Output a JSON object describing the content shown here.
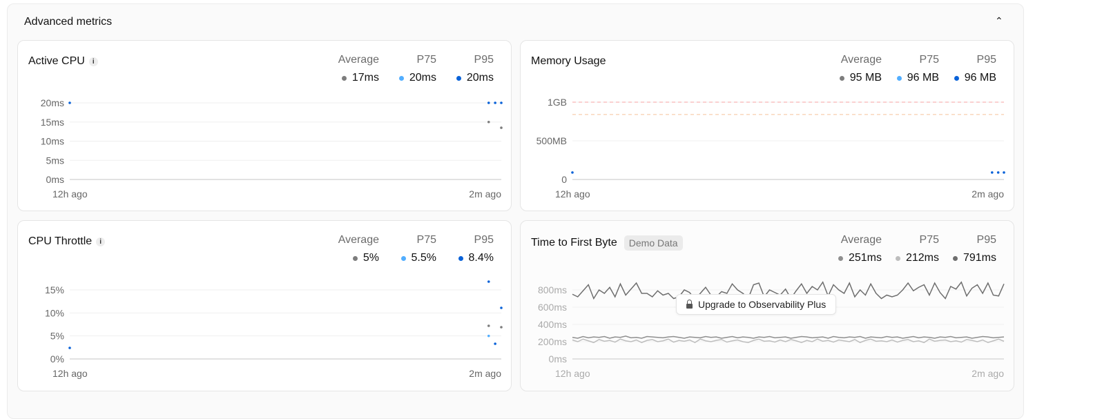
{
  "panel": {
    "title": "Advanced metrics",
    "collapse_icon": "chevron-up-icon",
    "collapse_glyph": "⌃"
  },
  "upgrade_label": "Upgrade to Observability Plus",
  "colors": {
    "avg": "#7d7d7d",
    "p75": "#52aeff",
    "p95": "#0a62d8",
    "demo_avg": "#8f8f8f",
    "demo_p75": "#bdbdbd",
    "demo_p95": "#6e6e6e",
    "limit": "#f7a0a0",
    "warn": "#f5c49a"
  },
  "cards": [
    {
      "id": "active-cpu",
      "title": "Active CPU",
      "info": true,
      "stats": [
        {
          "label": "Average",
          "value": "17ms",
          "color": "avg"
        },
        {
          "label": "P75",
          "value": "20ms",
          "color": "p75"
        },
        {
          "label": "P95",
          "value": "20ms",
          "color": "p95"
        }
      ],
      "chart_data": {
        "type": "scatter",
        "ylim": [
          0,
          20
        ],
        "yticks": [
          "0ms",
          "5ms",
          "10ms",
          "15ms",
          "20ms"
        ],
        "ytick_values": [
          0,
          5,
          10,
          15,
          20
        ],
        "x_labels": [
          "12h ago",
          "2m ago"
        ],
        "xlim_hours_ago": [
          12,
          0
        ],
        "series": [
          {
            "name": "P95",
            "color": "p95",
            "points": [
              [
                12,
                20
              ],
              [
                0.35,
                20
              ],
              [
                0.17,
                20
              ],
              [
                0,
                20
              ]
            ]
          },
          {
            "name": "Average",
            "color": "avg",
            "points": [
              [
                0.35,
                15
              ],
              [
                0,
                13.5
              ]
            ]
          }
        ]
      }
    },
    {
      "id": "memory-usage",
      "title": "Memory Usage",
      "info": false,
      "stats": [
        {
          "label": "Average",
          "value": "95 MB",
          "color": "avg"
        },
        {
          "label": "P75",
          "value": "96 MB",
          "color": "p75"
        },
        {
          "label": "P95",
          "value": "96 MB",
          "color": "p95"
        }
      ],
      "chart_data": {
        "type": "scatter",
        "ylim": [
          0,
          1000
        ],
        "yticks": [
          "0",
          "500MB",
          "1GB"
        ],
        "ytick_values": [
          0,
          500,
          1000
        ],
        "x_labels": [
          "12h ago",
          "2m ago"
        ],
        "xlim_hours_ago": [
          12,
          0
        ],
        "reference_lines": [
          {
            "value": 1000,
            "color": "limit"
          },
          {
            "value": 840,
            "color": "warn"
          }
        ],
        "series": [
          {
            "name": "P95",
            "color": "p95",
            "points": [
              [
                12,
                90
              ],
              [
                0.33,
                90
              ],
              [
                0.16,
                90
              ],
              [
                0,
                90
              ]
            ]
          }
        ]
      }
    },
    {
      "id": "cpu-throttle",
      "title": "CPU Throttle",
      "info": true,
      "stats": [
        {
          "label": "Average",
          "value": "5%",
          "color": "avg"
        },
        {
          "label": "P75",
          "value": "5.5%",
          "color": "p75"
        },
        {
          "label": "P95",
          "value": "8.4%",
          "color": "p95"
        }
      ],
      "chart_data": {
        "type": "scatter",
        "ylim": [
          0,
          15
        ],
        "yticks": [
          "0%",
          "5%",
          "10%",
          "15%"
        ],
        "ytick_values": [
          0,
          5,
          10,
          15
        ],
        "x_labels": [
          "12h ago",
          "2m ago"
        ],
        "xlim_hours_ago": [
          12,
          0
        ],
        "series": [
          {
            "name": "P95",
            "color": "p95",
            "points": [
              [
                12,
                2.4
              ],
              [
                0.35,
                16.8
              ],
              [
                0.17,
                3.3
              ],
              [
                0,
                11.1
              ]
            ]
          },
          {
            "name": "P75",
            "color": "p75",
            "points": [
              [
                0.35,
                5
              ]
            ]
          },
          {
            "name": "Average",
            "color": "avg",
            "points": [
              [
                0.35,
                7.2
              ],
              [
                0,
                6.9
              ]
            ]
          }
        ]
      }
    },
    {
      "id": "ttfb",
      "title": "Time to First Byte",
      "badge": "Demo Data",
      "info": false,
      "demo": true,
      "stats": [
        {
          "label": "Average",
          "value": "251ms",
          "color": "demo_avg"
        },
        {
          "label": "P75",
          "value": "212ms",
          "color": "demo_p75"
        },
        {
          "label": "P95",
          "value": "791ms",
          "color": "demo_p95"
        }
      ],
      "chart_data": {
        "type": "line",
        "ylim": [
          0,
          900
        ],
        "yticks": [
          "0ms",
          "200ms",
          "400ms",
          "600ms",
          "800ms"
        ],
        "ytick_values": [
          0,
          200,
          400,
          600,
          800
        ],
        "x_labels": [
          "12h ago",
          "2m ago"
        ],
        "series": [
          {
            "name": "P95",
            "color": "demo_p95",
            "values": [
              750,
              720,
              790,
              860,
              700,
              800,
              760,
              830,
              720,
              870,
              740,
              810,
              880,
              760,
              760,
              720,
              790,
              740,
              760,
              700,
              720,
              800,
              770,
              690,
              760,
              830,
              740,
              720,
              780,
              760,
              870,
              800,
              760,
              700,
              860,
              880,
              720,
              800,
              770,
              740,
              810,
              700,
              790,
              870,
              760,
              840,
              800,
              890,
              730,
              860,
              800,
              760,
              880,
              720,
              800,
              740,
              870,
              760,
              700,
              740,
              720,
              740,
              800,
              880,
              790,
              830,
              860,
              740,
              880,
              770,
              700,
              840,
              810,
              890,
              730,
              820,
              860,
              760,
              880,
              740,
              730,
              870
            ]
          },
          {
            "name": "Average",
            "color": "demo_avg",
            "values": [
              250,
              240,
              260,
              245,
              255,
              250,
              260,
              240,
              255,
              250,
              265,
              245,
              250,
              240,
              260,
              255,
              250,
              245,
              255,
              260,
              250,
              240,
              255,
              250,
              245,
              260,
              250,
              255,
              240,
              250,
              260,
              245,
              255,
              250,
              240,
              255,
              250,
              260,
              245,
              250,
              255,
              240,
              250,
              260,
              255,
              245,
              250,
              255,
              240,
              260,
              250,
              245,
              255,
              250,
              260,
              240,
              255,
              250,
              245,
              260,
              250,
              255,
              240,
              250,
              260,
              245,
              255,
              250,
              240,
              255,
              250,
              260,
              245,
              250,
              255,
              240,
              250,
              260,
              255,
              245,
              250,
              255
            ]
          },
          {
            "name": "P75",
            "color": "demo_p75",
            "values": [
              220,
              200,
              230,
              210,
              190,
              225,
              205,
              215,
              195,
              230,
              210,
              200,
              220,
              190,
              215,
              225,
              200,
              210,
              230,
              195,
              215,
              205,
              220,
              190,
              230,
              210,
              200,
              215,
              225,
              195,
              210,
              220,
              200,
              190,
              215,
              230,
              205,
              210,
              195,
              220,
              200,
              225,
              210,
              190,
              215,
              200,
              230,
              205,
              215,
              195,
              220,
              210,
              200,
              225,
              190,
              215,
              230,
              205,
              210,
              200,
              220,
              195,
              215,
              225,
              200,
              210,
              190,
              230,
              205,
              215,
              220,
              200,
              210,
              195,
              225,
              215,
              200,
              220,
              190,
              210,
              230,
              205
            ]
          }
        ]
      }
    }
  ]
}
